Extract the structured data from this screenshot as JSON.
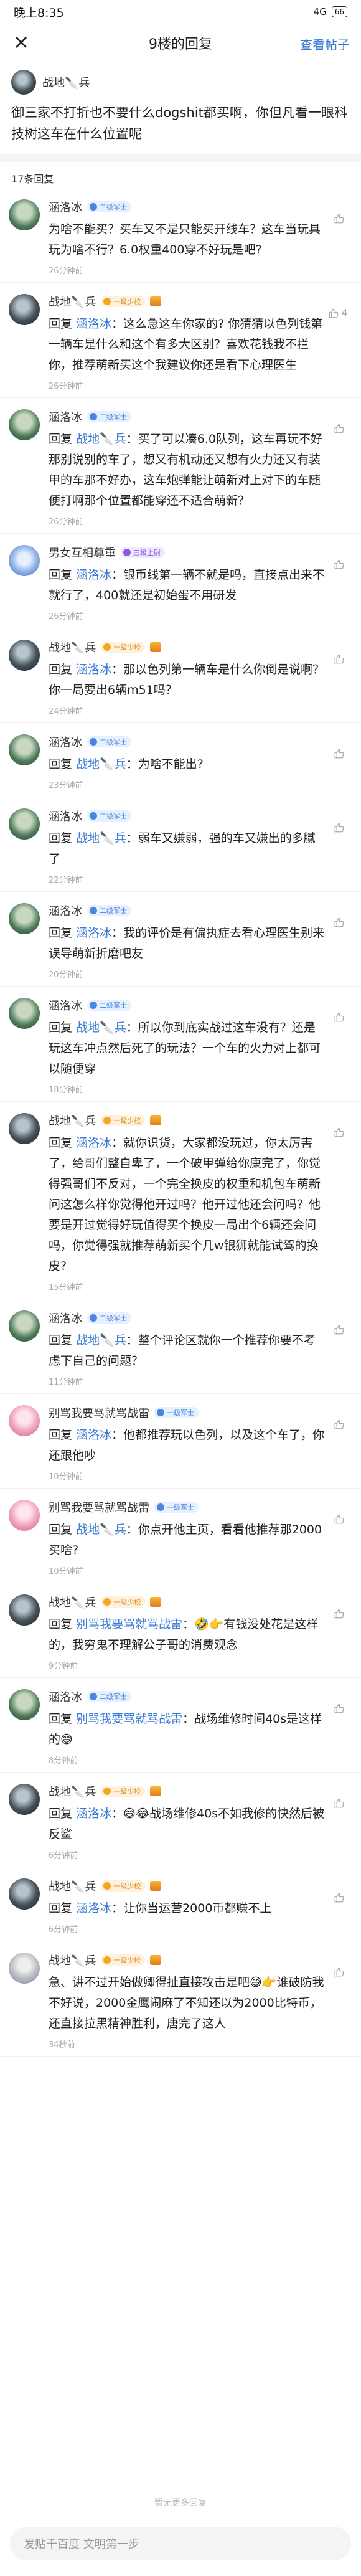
{
  "status": {
    "time": "晚上8:35",
    "signal": "4G",
    "battery": "66"
  },
  "nav": {
    "title": "9楼的回复",
    "action": "查看帖子"
  },
  "op": {
    "author": "战地🔪兵",
    "text": "御三家不打折也不要什么dogshit都买啊，你但凡看一眼科技树这车在什么位置呢"
  },
  "reply_count": "17条回复",
  "replies": [
    {
      "user": "涵洛冰",
      "badge": "二级军士",
      "badge_color": "blue",
      "avatar": "green",
      "prefix": "",
      "target": "",
      "text": "为啥不能买？买车又不是只能买开线车？这车当玩具玩为啥不行？6.0权重400穿不好玩是吧?",
      "time": "26分钟前",
      "likes": ""
    },
    {
      "user": "战地🔪兵",
      "badge": "一级少校",
      "badge_color": "orange",
      "avatar": "dark",
      "prefix": "回复",
      "target": "涵洛冰",
      "text": "：这么急这车你家的? 你猜猜以色列钱第一辆车是什么和这个有多大区别？喜欢花钱我不拦你，推荐萌新买这个我建议你还是看下心理医生",
      "time": "26分钟前",
      "likes": "4"
    },
    {
      "user": "涵洛冰",
      "badge": "二级军士",
      "badge_color": "blue",
      "avatar": "green",
      "prefix": "回复",
      "target": "战地🔪兵",
      "text": "：买了可以凑6.0队列，这车再玩不好那别说别的车了，想又有机动还又想有火力还又有装甲的车那不好办，这车炮弹能让萌新对上对下的车随便打啊那个位置都能穿还不适合萌新？",
      "time": "26分钟前",
      "likes": ""
    },
    {
      "user": "男女互相尊重",
      "badge": "三级上尉",
      "badge_color": "purple",
      "avatar": "blue",
      "prefix": "回复",
      "target": "涵洛冰",
      "text": "：银币线第一辆不就是吗，直接点出来不就行了，400就还是初始蛋不用研发",
      "time": "26分钟前",
      "likes": ""
    },
    {
      "user": "战地🔪兵",
      "badge": "一级少校",
      "badge_color": "orange",
      "avatar": "dark",
      "prefix": "回复",
      "target": "涵洛冰",
      "text": "：那以色列第一辆车是什么你倒是说啊？你一局要出6辆m51吗？",
      "time": "24分钟前",
      "likes": ""
    },
    {
      "user": "涵洛冰",
      "badge": "二级军士",
      "badge_color": "blue",
      "avatar": "green",
      "prefix": "回复",
      "target": "战地🔪兵",
      "text": "：为啥不能出?",
      "time": "23分钟前",
      "likes": ""
    },
    {
      "user": "涵洛冰",
      "badge": "二级军士",
      "badge_color": "blue",
      "avatar": "green",
      "prefix": "回复",
      "target": "战地🔪兵",
      "text": "：弱车又嫌弱，强的车又嫌出的多腻了",
      "time": "22分钟前",
      "likes": ""
    },
    {
      "user": "涵洛冰",
      "badge": "二级军士",
      "badge_color": "blue",
      "avatar": "green",
      "prefix": "回复",
      "target": "涵洛冰",
      "text": "：我的评价是有偏执症去看心理医生别来误导萌新折磨吧友",
      "time": "20分钟前",
      "likes": ""
    },
    {
      "user": "涵洛冰",
      "badge": "二级军士",
      "badge_color": "blue",
      "avatar": "green",
      "prefix": "回复",
      "target": "战地🔪兵",
      "text": "：所以你到底实战过这车没有？还是玩这车冲点然后死了的玩法？一个车的火力对上都可以随便穿",
      "time": "18分钟前",
      "likes": ""
    },
    {
      "user": "战地🔪兵",
      "badge": "一级少校",
      "badge_color": "orange",
      "avatar": "dark",
      "prefix": "回复",
      "target": "涵洛冰",
      "text": "：就你识货，大家都没玩过，你太厉害了，给哥们整自卑了，一个破甲弹给你康完了，你觉得强哥们不反对，一个完全换皮的权重和机包车萌新问这怎么样你觉得他开过吗？他开过他还会问吗？他要是开过觉得好玩值得买个换皮一局出个6辆还会问吗，你觉得强就推荐萌新买个几w银狮就能试驾的换皮?",
      "time": "15分钟前",
      "likes": ""
    },
    {
      "user": "涵洛冰",
      "badge": "二级军士",
      "badge_color": "blue",
      "avatar": "green",
      "prefix": "回复",
      "target": "战地🔪兵",
      "text": "：整个评论区就你一个推荐你要不考虑下自己的问题？",
      "time": "11分钟前",
      "likes": ""
    },
    {
      "user": "别骂我要骂就骂战雷",
      "badge": "一级军士",
      "badge_color": "blue",
      "avatar": "pink",
      "prefix": "回复",
      "target": "涵洛冰",
      "text": "：他都推荐玩以色列，以及这个车了，你还跟他吵",
      "time": "10分钟前",
      "likes": ""
    },
    {
      "user": "别骂我要骂就骂战雷",
      "badge": "一级军士",
      "badge_color": "blue",
      "avatar": "pink",
      "prefix": "回复",
      "target": "战地🔪兵",
      "text": "：你点开他主页，看看他推荐那2000买啥?",
      "time": "10分钟前",
      "likes": ""
    },
    {
      "user": "战地🔪兵",
      "badge": "一级少校",
      "badge_color": "orange",
      "avatar": "dark",
      "prefix": "回复",
      "target": "别骂我要骂就骂战雷",
      "text": "：🤣👉有钱没处花是这样的，我穷鬼不理解公子哥的消费观念",
      "time": "9分钟前",
      "likes": ""
    },
    {
      "user": "涵洛冰",
      "badge": "二级军士",
      "badge_color": "blue",
      "avatar": "green",
      "prefix": "回复",
      "target": "别骂我要骂就骂战雷",
      "text": "：战场维修时间40s是这样的😅",
      "time": "8分钟前",
      "likes": ""
    },
    {
      "user": "战地🔪兵",
      "badge": "一级少校",
      "badge_color": "orange",
      "avatar": "dark",
      "prefix": "回复",
      "target": "涵洛冰",
      "text": "：😅😂战场维修40s不如我修的快然后被反鲨",
      "time": "6分钟前",
      "likes": ""
    },
    {
      "user": "战地🔪兵",
      "badge": "一级少校",
      "badge_color": "orange",
      "avatar": "dark",
      "prefix": "回复",
      "target": "涵洛冰",
      "text": "：让你当运营2000币都赚不上",
      "time": "6分钟前",
      "likes": ""
    },
    {
      "user": "战地🔪兵",
      "badge": "一级少校",
      "badge_color": "orange",
      "avatar": "gray",
      "prefix": "",
      "target": "",
      "text": "急、讲不过开始做卿得扯直接攻击是吧😅👉谁破防我不好说，2000金鹰闹麻了不知还以为2000比特币，还直接拉黑精神胜利，唐完了这人",
      "time": "34秒前",
      "likes": ""
    }
  ],
  "footer_note": "暂无更多回复",
  "input_placeholder": "发贴千百度  文明第一步"
}
